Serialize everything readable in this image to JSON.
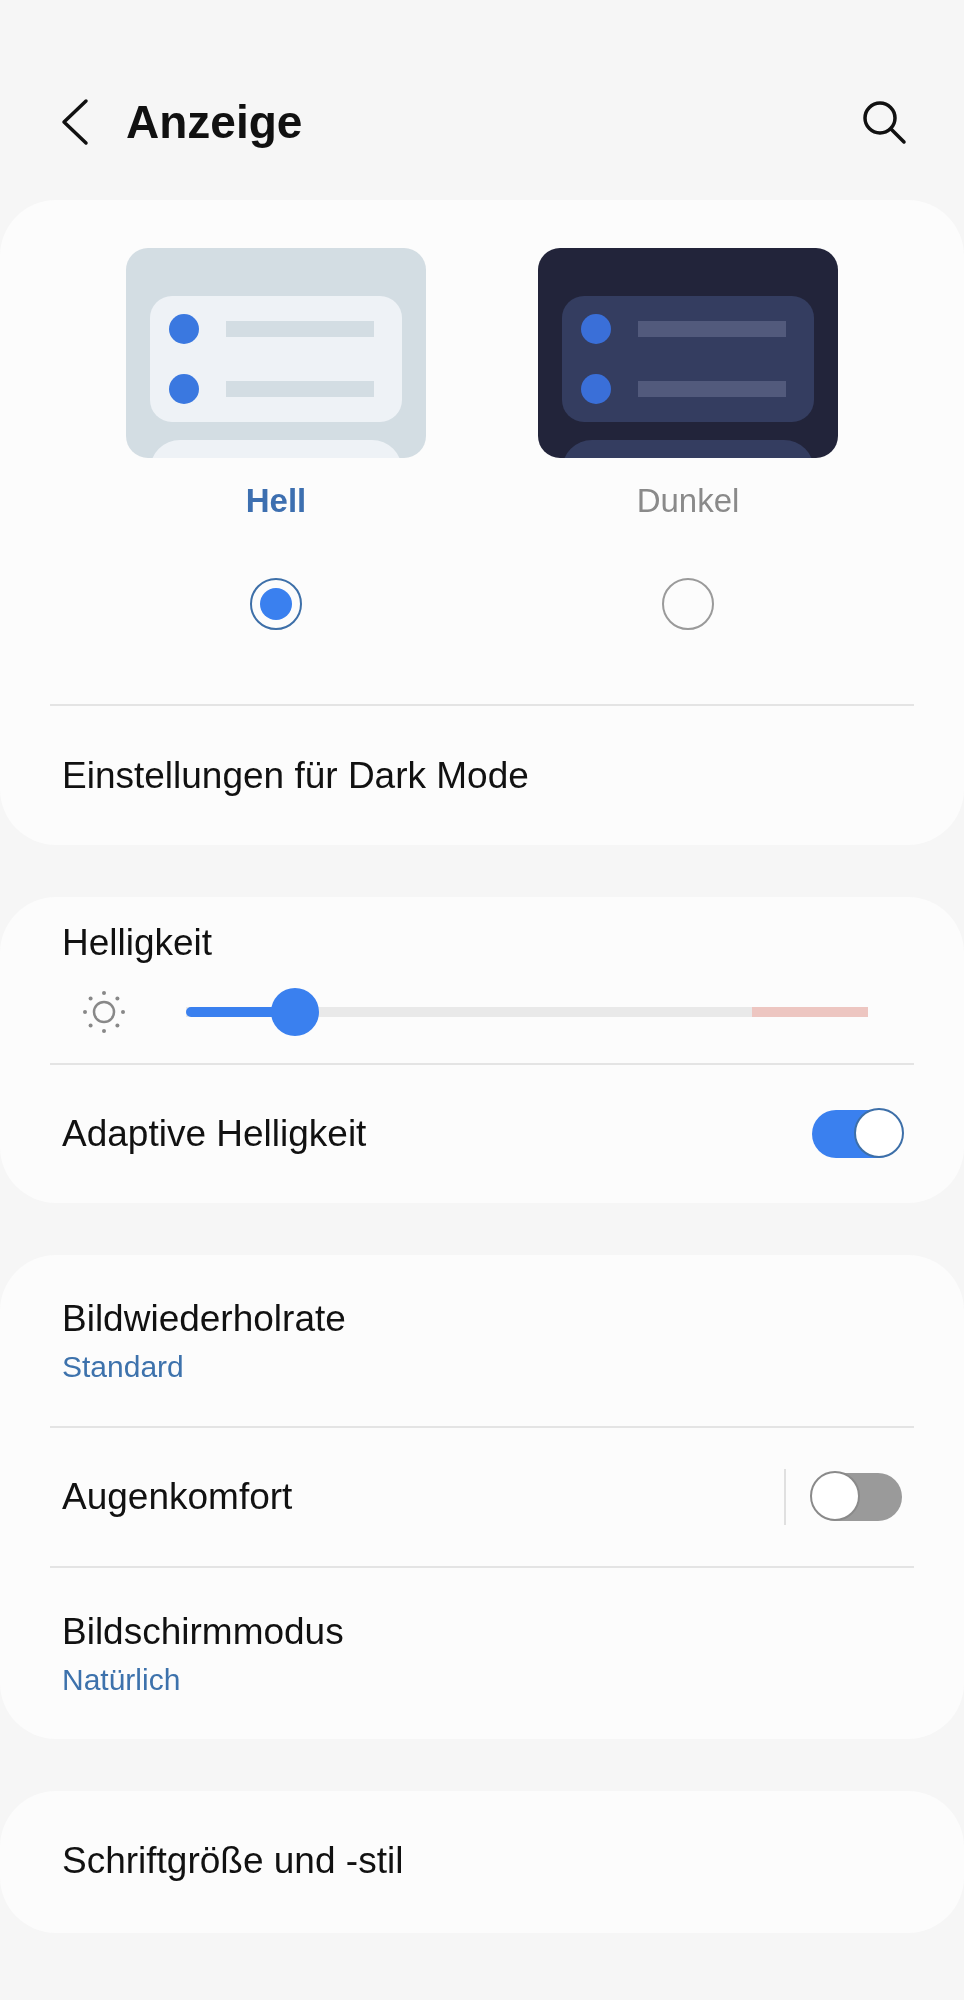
{
  "header": {
    "title": "Anzeige"
  },
  "cards": [
    {
      "kind": "theme",
      "modes": [
        {
          "label": "Hell",
          "kind": "light",
          "selected": true
        },
        {
          "label": "Dunkel",
          "kind": "dark",
          "selected": false
        }
      ],
      "items": [
        {
          "kind": "link",
          "title": "Einstellungen für Dark Mode"
        }
      ]
    },
    {
      "kind": "list",
      "items": [
        {
          "kind": "slider",
          "title": "Helligkeit",
          "level": 0.16
        },
        {
          "kind": "switch",
          "title": "Adaptive Helligkeit",
          "on": true
        }
      ]
    },
    {
      "kind": "list",
      "items": [
        {
          "kind": "value",
          "title": "Bildwiederholrate",
          "value": "Standard"
        },
        {
          "kind": "split-switch",
          "title": "Augenkomfort",
          "on": false
        },
        {
          "kind": "value",
          "title": "Bildschirmmodus",
          "value": "Natürlich"
        }
      ]
    },
    {
      "kind": "list",
      "items": [
        {
          "kind": "link",
          "title": "Schriftgröße und -stil"
        }
      ]
    }
  ]
}
